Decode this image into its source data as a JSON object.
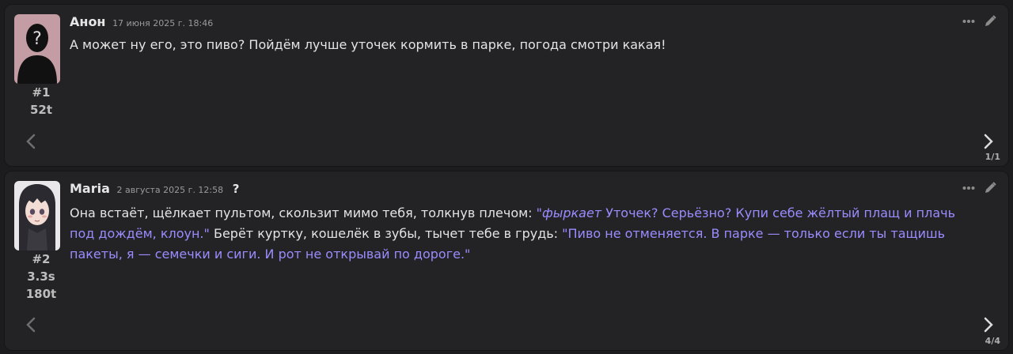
{
  "messages": [
    {
      "id_label": "#1",
      "name": "Анон",
      "timestamp": "17 июня 2025 г. 18:46",
      "tokens": "52t",
      "text": "А может ну его, это пиво? Пойдём лучше уточек кормить в парке, погода смотри какая!",
      "swipe_counter": "1/1",
      "avatar": "anonymous-silhouette"
    },
    {
      "id_label": "#2",
      "name": "Maria",
      "timestamp": "2 августа 2025 г. 12:58",
      "info_icon": "?",
      "gen_time": "3.3s",
      "tokens": "180t",
      "text_parts": {
        "p1": "Она встаёт, щёлкает пультом, скользит мимо тебя, толкнув плечом: ",
        "q1_open": "\"",
        "q1_em": "фыркает",
        "q1_rest": " Уточек? Серьёзно? Купи себе жёлтый плащ и плачь под дождём, клоун.\"",
        "p2": " Берёт куртку, кошелёк в зубы, тычет тебе в грудь: ",
        "q2": "\"Пиво не отменяется. В парке — только если ты тащишь пакеты, я — семечки и сиги. И рот не открывай по дороге.\""
      },
      "swipe_counter": "4/4",
      "avatar": "anime-girl-portrait"
    }
  ],
  "icons": {
    "more": "ellipsis-icon",
    "edit": "pencil-icon",
    "swipe_left": "chevron-left-icon",
    "swipe_right": "chevron-right-icon"
  },
  "colors": {
    "background": "#1c1c1e",
    "card": "#232325",
    "quote": "#9a8cff",
    "text": "#e4e4e4"
  }
}
